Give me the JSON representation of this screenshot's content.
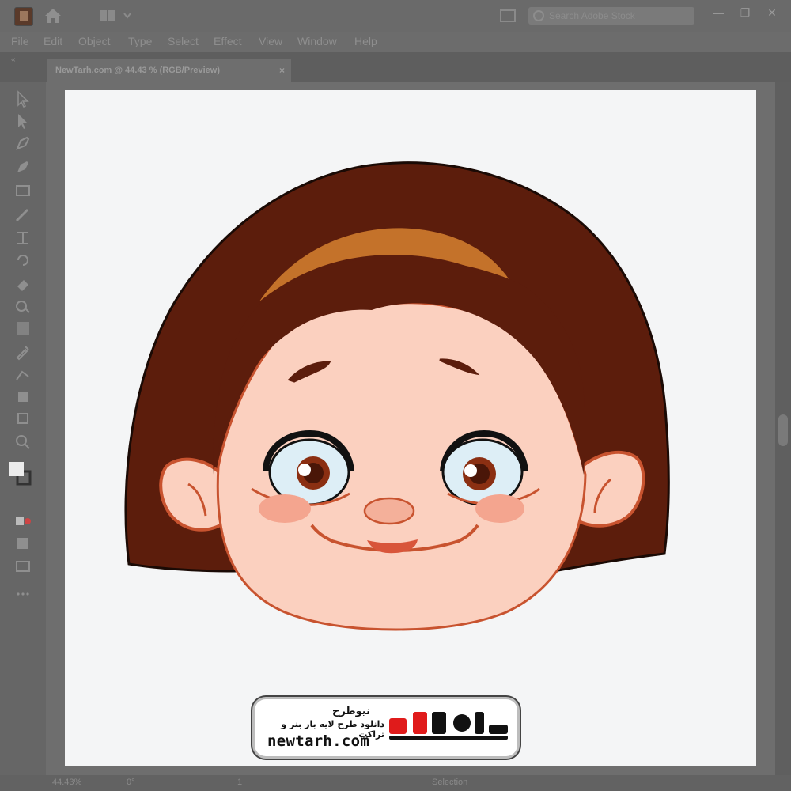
{
  "window": {
    "search_placeholder": "Search Adobe Stock"
  },
  "menu": {
    "items": [
      "File",
      "Edit",
      "Object",
      "Type",
      "Select",
      "Effect",
      "View",
      "Window",
      "Help"
    ]
  },
  "document_tab": {
    "label": "NewTarh.com @ 44.43 % (RGB/Preview)",
    "close": "×"
  },
  "status": {
    "zoom": "44.43%",
    "rotation": "0°",
    "artboard": "1",
    "tool": "Selection"
  },
  "watermark": {
    "fa_title": "نیوطرح",
    "fa_subtitle": "دانلود طرح لایه باز بنر و تراکت",
    "logo_text": "نیوطرح",
    "url": "newtarh.com"
  },
  "colors": {
    "hair": "#5c1d0c",
    "headband": "#c4722a",
    "skin": "#fbd0bf",
    "outline": "#c8532f",
    "cheek": "#f4a58f",
    "logo_red": "#e01b1b"
  }
}
